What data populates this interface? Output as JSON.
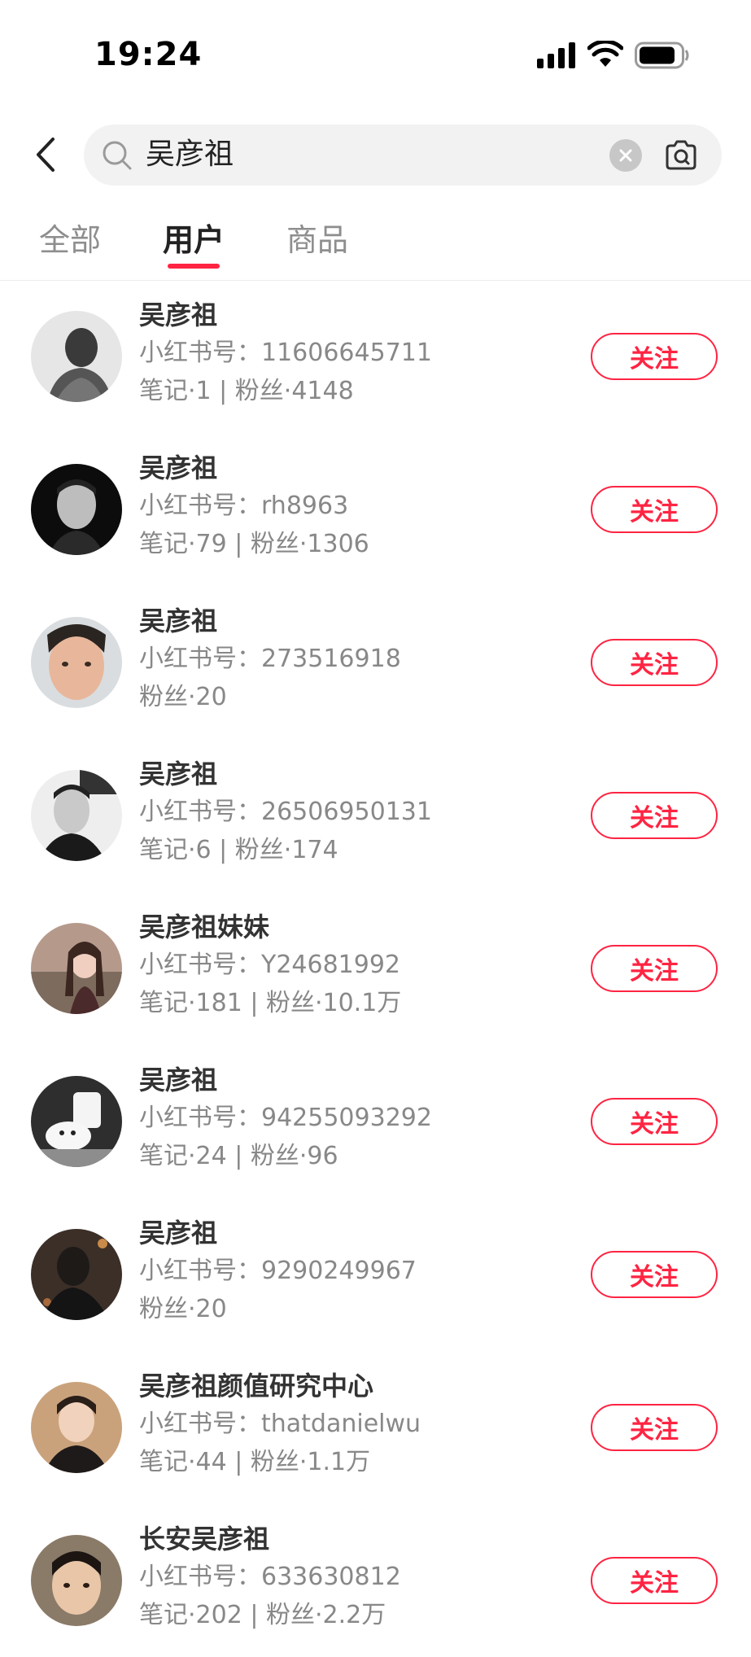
{
  "status_bar": {
    "time": "19:24"
  },
  "search": {
    "query": "吴彦祖"
  },
  "tabs": [
    {
      "label": "全部"
    },
    {
      "label": "用户"
    },
    {
      "label": "商品"
    }
  ],
  "active_tab": "用户",
  "accent_color": "#ff2442",
  "users": [
    {
      "name": "吴彦祖",
      "id_label": "小红书号：11606645711",
      "stats": "笔记·1 | 粉丝·4148",
      "follow_label": "关注",
      "avatar": "grayscale-portrait"
    },
    {
      "name": "吴彦祖",
      "id_label": "小红书号：rh8963",
      "stats": "笔记·79 | 粉丝·1306",
      "follow_label": "关注",
      "avatar": "bw-portrait"
    },
    {
      "name": "吴彦祖",
      "id_label": "小红书号：273516918",
      "stats": "粉丝·20",
      "follow_label": "关注",
      "avatar": "selfie-portrait"
    },
    {
      "name": "吴彦祖",
      "id_label": "小红书号：26506950131",
      "stats": "笔记·6 | 粉丝·174",
      "follow_label": "关注",
      "avatar": "magazine-portrait"
    },
    {
      "name": "吴彦祖妹妹",
      "id_label": "小红书号：Y24681992",
      "stats": "笔记·181 | 粉丝·10.1万",
      "follow_label": "关注",
      "avatar": "girl-landscape"
    },
    {
      "name": "吴彦祖",
      "id_label": "小红书号：94255093292",
      "stats": "笔记·24 | 粉丝·96",
      "follow_label": "关注",
      "avatar": "white-dog"
    },
    {
      "name": "吴彦祖",
      "id_label": "小红书号：9290249967",
      "stats": "粉丝·20",
      "follow_label": "关注",
      "avatar": "dark-portrait"
    },
    {
      "name": "吴彦祖颜值研究中心",
      "id_label": "小红书号：thatdanielwu",
      "stats": "笔记·44 | 粉丝·1.1万",
      "follow_label": "关注",
      "avatar": "warm-portrait"
    },
    {
      "name": "长安吴彦祖",
      "id_label": "小红书号：633630812",
      "stats": "笔记·202 | 粉丝·2.2万",
      "follow_label": "关注",
      "avatar": "child-portrait"
    }
  ]
}
